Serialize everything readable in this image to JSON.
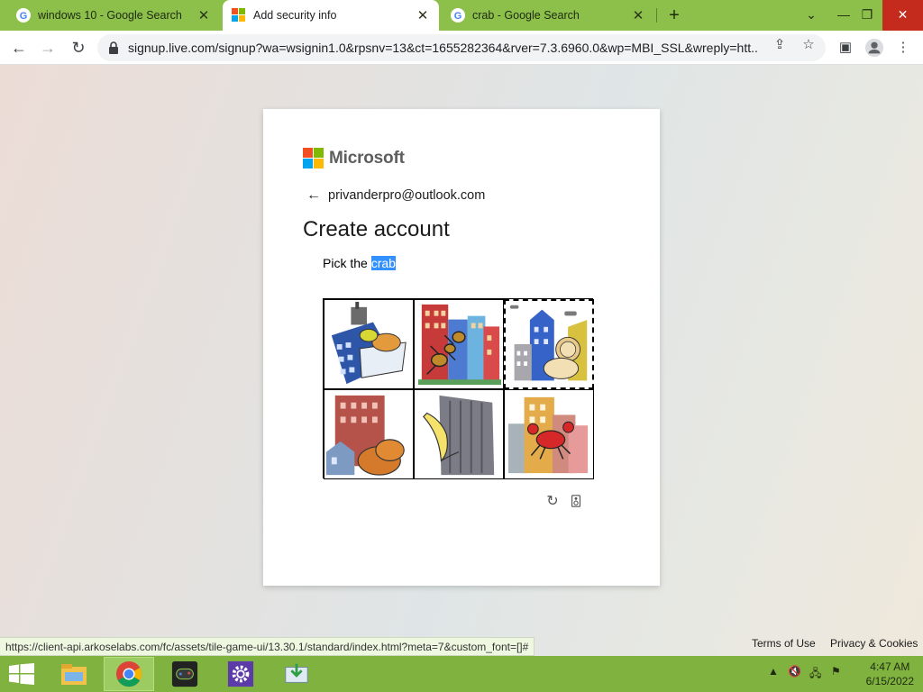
{
  "browser": {
    "tabs": [
      {
        "label": "windows 10 - Google Search",
        "icon": "google-icon",
        "active": false
      },
      {
        "label": "Add security info",
        "icon": "microsoft-icon",
        "active": true
      },
      {
        "label": "crab - Google Search",
        "icon": "google-icon",
        "active": false
      }
    ],
    "new_tab": "+",
    "url": "signup.live.com/signup?wa=wsignin1.0&rpsnv=13&ct=1655282364&rver=7.3.6960.0&wp=MBI_SSL&wreply=htt...",
    "status_url": "https://client-api.arkoselabs.com/fc/assets/tile-game-ui/13.30.1/standard/index.html?meta=7&custom_font=[]#"
  },
  "card": {
    "brand": "Microsoft",
    "email": "privanderpro@outlook.com",
    "title": "Create account",
    "instruction_prefix": "Pick the",
    "instruction_target": "crab",
    "tiles": [
      {
        "subject": "bird-on-building",
        "selected": false
      },
      {
        "subject": "ant-on-buildings",
        "selected": false
      },
      {
        "subject": "lion-with-buildings",
        "selected": true
      },
      {
        "subject": "bread-with-buildings",
        "selected": false
      },
      {
        "subject": "banana-with-building",
        "selected": false
      },
      {
        "subject": "crab-with-buildings",
        "selected": false
      }
    ]
  },
  "footer": {
    "terms": "Terms of Use",
    "privacy": "Privacy & Cookies"
  },
  "taskbar": {
    "time": "4:47 AM",
    "date": "6/15/2022"
  },
  "colors": {
    "tabstrip": "#8cc04b",
    "taskbar": "#7fb23f",
    "highlight": "#3390ff",
    "ms_red": "#f25022",
    "ms_green": "#7fba00",
    "ms_blue": "#00a4ef",
    "ms_yellow": "#ffb900"
  }
}
